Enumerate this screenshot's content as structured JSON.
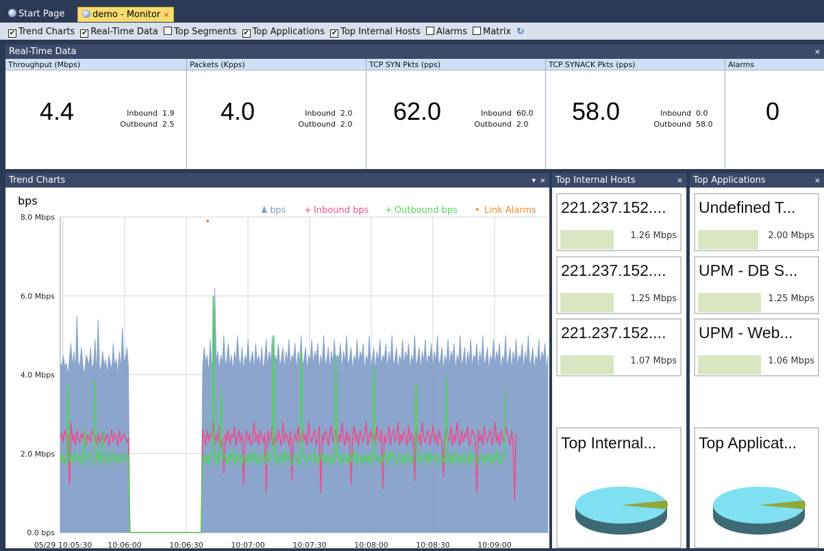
{
  "tabs": [
    {
      "label": "Start Page"
    },
    {
      "label": "demo - Monitor",
      "close": "×"
    }
  ],
  "toolbar": {
    "options": [
      {
        "label": "Trend Charts",
        "checked": true
      },
      {
        "label": "Real-Time Data",
        "checked": true
      },
      {
        "label": "Top Segments",
        "checked": false
      },
      {
        "label": "Top Applications",
        "checked": true
      },
      {
        "label": "Top Internal Hosts",
        "checked": true
      },
      {
        "label": "Alarms",
        "checked": false
      },
      {
        "label": "Matrix",
        "checked": false
      }
    ],
    "check_mark": "✔",
    "refresh_glyph": "↻"
  },
  "realtime": {
    "title": "Real-Time Data",
    "close": "×",
    "metrics": [
      {
        "header": "Throughput (Mbps)",
        "value": "4.4",
        "inbound_label": "Inbound",
        "inbound": "1.9",
        "outbound_label": "Outbound",
        "outbound": "2.5"
      },
      {
        "header": "Packets (Kpps)",
        "value": "4.0",
        "inbound_label": "Inbound",
        "inbound": "2.0",
        "outbound_label": "Outbound",
        "outbound": "2.0"
      },
      {
        "header": "TCP SYN Pkts (pps)",
        "value": "62.0",
        "inbound_label": "Inbound",
        "inbound": "60.0",
        "outbound_label": "Outbound",
        "outbound": "2.0"
      },
      {
        "header": "TCP SYNACK Pkts (pps)",
        "value": "58.0",
        "inbound_label": "Inbound",
        "inbound": "0.0",
        "outbound_label": "Outbound",
        "outbound": "58.0"
      },
      {
        "header": "Alarms",
        "value": "0"
      }
    ]
  },
  "trend": {
    "title": "Trend Charts",
    "dropdown": "▾",
    "close": "×"
  },
  "hosts": {
    "title": "Top Internal Hosts",
    "close": "×",
    "items": [
      {
        "name": "221.237.152....",
        "value": "1.26 Mbps"
      },
      {
        "name": "221.237.152....",
        "value": "1.25 Mbps"
      },
      {
        "name": "221.237.152....",
        "value": "1.07 Mbps"
      }
    ],
    "pie_title": "Top Internal..."
  },
  "apps": {
    "title": "Top Applications",
    "close": "×",
    "items": [
      {
        "name": "Undefined T...",
        "value": "2.00 Mbps"
      },
      {
        "name": "UPM - DB S...",
        "value": "1.25 Mbps"
      },
      {
        "name": "UPM - Web...",
        "value": "1.06 Mbps"
      }
    ],
    "pie_title": "Top Applicat..."
  },
  "colors": {
    "bps": "#7f9cc7",
    "inbound": "#e8508f",
    "outbound": "#4fd35a",
    "alarms": "#f0892a",
    "header_bg": "#3b4a66"
  },
  "chart_data": {
    "type": "area",
    "title": "bps",
    "xlabel": "",
    "ylabel": "bps",
    "ylim": [
      0,
      8
    ],
    "y_ticks": [
      "0.0 bps",
      "2.0 Mbps",
      "4.0 Mbps",
      "6.0 Mbps",
      "8.0 Mbps"
    ],
    "x_ticks": [
      "05/29 10:05:30",
      "10:06:00",
      "10:06:30",
      "10:07:00",
      "10:07:30",
      "10:08:00",
      "10:08:30",
      "10:09:00"
    ],
    "x_range": [
      "10:05:30",
      "10:09:15"
    ],
    "grid": true,
    "legend_position": "top-right",
    "legend": [
      "bps",
      "Inbound bps",
      "Outbound bps",
      "Link Alarms"
    ],
    "series": [
      {
        "name": "bps",
        "type": "area",
        "samples_per_30s": 24,
        "values": [
          4.3,
          4.2,
          4.5,
          4.2,
          4.3,
          4.0,
          4.4,
          4.8,
          4.2,
          4.6,
          4.1,
          5.5,
          4.2,
          4.3,
          4.7,
          4.2,
          4.0,
          4.5,
          4.4,
          4.2,
          4.7,
          4.1,
          4.3,
          4.9,
          4.0,
          5.4,
          4.1,
          4.2,
          4.6,
          4.2,
          4.4,
          4.0,
          4.5,
          4.3,
          4.1,
          4.8,
          4.2,
          4.4,
          4.0,
          4.6,
          4.1,
          5.2,
          4.3,
          4.4,
          4.7,
          4.2,
          0.0,
          0.0,
          0.0,
          0.0,
          0.0,
          0.0,
          0.0,
          0.0,
          0.0,
          0.0,
          0.0,
          0.0,
          0.0,
          0.0,
          0.0,
          0.0,
          0.0,
          0.0,
          0.0,
          0.0,
          0.0,
          0.0,
          0.0,
          0.0,
          0.0,
          0.0,
          0.0,
          0.0,
          0.0,
          0.0,
          0.0,
          0.0,
          0.0,
          0.0,
          0.0,
          0.0,
          0.0,
          0.0,
          0.0,
          0.0,
          0.0,
          0.0,
          0.0,
          0.0,
          0.0,
          0.0,
          0.0,
          0.0,
          4.2,
          4.7,
          4.3,
          4.5,
          4.0,
          4.9,
          4.2,
          4.4,
          6.2,
          4.3,
          4.6,
          4.1,
          4.5,
          4.3,
          5.0,
          4.2,
          4.4,
          4.8,
          4.2,
          4.5,
          4.1,
          4.6,
          4.3,
          5.0,
          4.4,
          4.2,
          4.7,
          4.1,
          4.5,
          4.3,
          4.9,
          4.2,
          4.4,
          4.6,
          4.1,
          4.8,
          4.3,
          4.5,
          4.2,
          4.7,
          4.1,
          4.4,
          4.9,
          4.2,
          4.6,
          4.3,
          5.0,
          4.1,
          4.5,
          4.3,
          4.8,
          4.2,
          4.4,
          4.7,
          4.1,
          4.6,
          4.3,
          4.9,
          4.2,
          4.5,
          4.4,
          4.8,
          4.1,
          4.6,
          4.3,
          5.0,
          4.2,
          4.4,
          4.7,
          4.1,
          4.5,
          4.3,
          4.9,
          4.2,
          4.6,
          4.4,
          4.8,
          4.1,
          4.5,
          4.3,
          5.0,
          4.2,
          4.4,
          4.7,
          4.1,
          4.6,
          4.3,
          4.9,
          4.2,
          4.5,
          4.4,
          4.8,
          4.1,
          4.6,
          4.3,
          5.0,
          4.2,
          4.4,
          4.7,
          4.1,
          4.5,
          4.3,
          4.9,
          4.2,
          4.6,
          4.4,
          4.8,
          4.1,
          4.5,
          4.3,
          5.0,
          4.2,
          4.4,
          4.7,
          4.1,
          4.6,
          4.3,
          4.9,
          4.2,
          4.5,
          4.4,
          4.8,
          4.1,
          4.6,
          4.3,
          5.0,
          4.2,
          4.4,
          4.7,
          4.1,
          4.5,
          4.3,
          4.9,
          4.2,
          4.6,
          4.4,
          4.8,
          4.1,
          4.5,
          4.3,
          5.0,
          4.2,
          4.4,
          4.7,
          4.1,
          4.6,
          4.3,
          4.9,
          4.2,
          4.5,
          4.4,
          4.8,
          4.1,
          4.6,
          4.3,
          5.0,
          4.2,
          4.4,
          4.7,
          4.1,
          4.5,
          4.3,
          4.9,
          4.2,
          4.6,
          4.4,
          4.8,
          4.1,
          4.5,
          4.3,
          5.0,
          4.2,
          4.4,
          4.7,
          4.1,
          4.6,
          4.3,
          4.9,
          4.2,
          4.5,
          4.4,
          4.8,
          4.1,
          4.6,
          4.3,
          5.0,
          4.2,
          4.4,
          4.7,
          4.1,
          4.5,
          4.3,
          4.9,
          4.2,
          4.6,
          4.4,
          4.8,
          4.1,
          4.5,
          4.3,
          5.0,
          4.2,
          4.4,
          4.7,
          4.1,
          4.6,
          4.3,
          4.9,
          4.2,
          4.5,
          4.4,
          4.8,
          4.1,
          4.6,
          4.3,
          5.0,
          4.2,
          4.4,
          4.7,
          4.1,
          4.5,
          4.3,
          4.9,
          4.2,
          4.6,
          4.4,
          4.8,
          4.1,
          4.5
        ]
      },
      {
        "name": "Inbound bps",
        "type": "line",
        "values": [
          2.4,
          2.5,
          2.3,
          2.6,
          2.4,
          2.5,
          1.2,
          2.8,
          2.3,
          2.5,
          2.2,
          2.6,
          2.4,
          2.3,
          2.5,
          2.4,
          2.6,
          2.2,
          2.5,
          2.4,
          2.3,
          2.6,
          2.5,
          2.4,
          2.2,
          2.5,
          2.3,
          2.4,
          2.6,
          2.3,
          2.4,
          2.5,
          2.2,
          2.4,
          2.6,
          2.3,
          2.5,
          2.4,
          2.2,
          2.6,
          2.3,
          2.4,
          2.5,
          2.4,
          2.3,
          2.4,
          0.0,
          0.0,
          0.0,
          0.0,
          0.0,
          0.0,
          0.0,
          0.0,
          0.0,
          0.0,
          0.0,
          0.0,
          0.0,
          0.0,
          0.0,
          0.0,
          0.0,
          0.0,
          0.0,
          0.0,
          0.0,
          0.0,
          0.0,
          0.0,
          0.0,
          0.0,
          0.0,
          0.0,
          0.0,
          0.0,
          0.0,
          0.0,
          0.0,
          0.0,
          0.0,
          0.0,
          0.0,
          0.0,
          0.0,
          0.0,
          0.0,
          0.0,
          0.0,
          0.0,
          0.0,
          0.0,
          0.0,
          0.0,
          2.6,
          2.4,
          2.2,
          2.6,
          2.3,
          2.5,
          2.4,
          2.8,
          2.2,
          2.5,
          2.3,
          2.7,
          2.2,
          2.4,
          1.5,
          2.5,
          2.3,
          2.6,
          2.2,
          2.5,
          2.4,
          2.7,
          2.2,
          2.4,
          2.6,
          2.3,
          2.5,
          1.2,
          2.4,
          2.6,
          2.3,
          2.5,
          2.2,
          2.4,
          2.8,
          2.3,
          2.5,
          2.2,
          2.6,
          2.4,
          2.3,
          2.5,
          1.0,
          2.6,
          2.3,
          2.4,
          2.7,
          2.2,
          2.5,
          2.3,
          2.6,
          2.4,
          2.2,
          2.8,
          2.3,
          2.5,
          2.4,
          2.2,
          2.6,
          1.3,
          2.4,
          2.5,
          2.3,
          2.7,
          2.2,
          2.4,
          2.6,
          2.3,
          2.5,
          2.2,
          2.8,
          2.4,
          2.3,
          2.5,
          2.6,
          2.2,
          2.4,
          2.7,
          1.0,
          2.5,
          2.3,
          2.6,
          2.4,
          2.2,
          2.5,
          2.7,
          2.3,
          2.4,
          2.6,
          2.2,
          2.5,
          2.3,
          2.8,
          2.4,
          2.2,
          2.6,
          2.3,
          2.5,
          1.2,
          2.4,
          2.7,
          2.3,
          2.5,
          2.2,
          2.6,
          2.4,
          2.3,
          2.5,
          2.8,
          2.2,
          2.4,
          2.6,
          2.3,
          2.5,
          2.2,
          2.7,
          2.4,
          2.3,
          2.6,
          1.1,
          2.5,
          2.3,
          2.4,
          2.7,
          2.2,
          2.5,
          2.6,
          2.3,
          2.4,
          2.8,
          2.2,
          2.5,
          2.3,
          2.6,
          2.4,
          2.2,
          2.7,
          2.3,
          2.5,
          2.4,
          1.3,
          2.6,
          2.3,
          2.5,
          2.2,
          2.8,
          2.4,
          2.3,
          2.5,
          2.6,
          2.2,
          2.4,
          2.7,
          2.3,
          2.5,
          2.2,
          2.6,
          2.4,
          2.3,
          1.4,
          2.5,
          2.6,
          2.3,
          2.4,
          2.7,
          2.2,
          2.5,
          2.3,
          2.8,
          2.4,
          2.2,
          2.6,
          2.3,
          2.5,
          2.4,
          2.7,
          2.2,
          2.3,
          2.6,
          2.5,
          2.4,
          1.0,
          2.6,
          2.3,
          2.5,
          2.2,
          2.7,
          2.4,
          2.3,
          2.5,
          2.6,
          2.2,
          2.4,
          2.8,
          2.3,
          2.5,
          2.2,
          2.6,
          2.4,
          2.3,
          2.7,
          2.5,
          2.4,
          2.2,
          2.6,
          2.3,
          0.8,
          2.5
        ]
      },
      {
        "name": "Outbound bps",
        "type": "line",
        "values": [
          1.9,
          1.8,
          2.0,
          1.7,
          1.9,
          3.8,
          1.8,
          2.0,
          1.7,
          1.9,
          2.1,
          1.8,
          1.9,
          2.0,
          1.7,
          1.9,
          2.6,
          1.8,
          1.9,
          2.0,
          1.8,
          1.7,
          1.9,
          3.9,
          1.8,
          2.0,
          1.9,
          1.7,
          2.6,
          1.8,
          1.9,
          2.0,
          1.7,
          1.9,
          2.1,
          1.8,
          1.9,
          2.0,
          1.7,
          1.9,
          1.8,
          2.0,
          1.9,
          1.8,
          1.9,
          2.0,
          0.0,
          0.0,
          0.0,
          0.0,
          0.0,
          0.0,
          0.0,
          0.0,
          0.0,
          0.0,
          0.0,
          0.0,
          0.0,
          0.0,
          0.0,
          0.0,
          0.0,
          0.0,
          0.0,
          0.0,
          0.0,
          0.0,
          0.0,
          0.0,
          0.0,
          0.0,
          0.0,
          0.0,
          0.0,
          0.0,
          0.0,
          0.0,
          0.0,
          0.0,
          0.0,
          0.0,
          0.0,
          0.0,
          0.0,
          0.0,
          0.0,
          0.0,
          0.0,
          0.0,
          0.0,
          0.0,
          0.0,
          0.0,
          1.9,
          2.0,
          1.8,
          1.9,
          1.7,
          2.0,
          1.9,
          6.0,
          1.8,
          2.0,
          1.7,
          1.9,
          3.6,
          1.8,
          2.0,
          1.9,
          1.7,
          2.0,
          1.8,
          1.9,
          2.1,
          1.7,
          1.9,
          2.0,
          1.8,
          1.9,
          1.7,
          2.0,
          1.9,
          1.8,
          2.0,
          1.7,
          1.9,
          2.1,
          1.8,
          1.9,
          1.7,
          2.0,
          1.9,
          1.8,
          2.0,
          1.9,
          1.7,
          2.1,
          1.8,
          1.9,
          2.0,
          5.0,
          1.7,
          1.9,
          1.8,
          2.0,
          1.9,
          1.7,
          2.1,
          1.8,
          1.9,
          2.0,
          1.8,
          1.7,
          1.9,
          2.0,
          1.8,
          1.9,
          1.7,
          4.6,
          1.9,
          2.0,
          1.8,
          1.7,
          1.9,
          2.0,
          1.8,
          1.9,
          2.1,
          1.7,
          1.9,
          1.8,
          2.0,
          1.9,
          1.7,
          2.0,
          1.8,
          1.9,
          2.0,
          1.7,
          1.9,
          1.8,
          4.5,
          1.9,
          2.0,
          1.7,
          1.9,
          1.8,
          2.0,
          1.9,
          1.7,
          2.0,
          1.8,
          1.9,
          2.1,
          1.7,
          1.9,
          2.0,
          1.8,
          1.9,
          1.7,
          2.0,
          1.9,
          1.8,
          2.0,
          1.7,
          1.9,
          4.2,
          1.8,
          1.9,
          2.0,
          1.7,
          1.9,
          1.8,
          2.0,
          1.9,
          1.7,
          2.1,
          1.8,
          1.9,
          2.0,
          1.8,
          1.7,
          1.9,
          2.0,
          1.8,
          1.9,
          1.7,
          2.0,
          1.9,
          1.8,
          2.0,
          1.7,
          1.9,
          2.1,
          3.8,
          1.9,
          1.7,
          2.0,
          1.9,
          1.8,
          2.0,
          1.9,
          1.7,
          2.1,
          1.8,
          1.9,
          2.0,
          1.8,
          1.7,
          1.9,
          2.0,
          1.8,
          1.9,
          1.7,
          4.0,
          1.9,
          1.8,
          2.0,
          1.7,
          1.9,
          2.1,
          1.8,
          1.9,
          1.7,
          2.0,
          1.9,
          1.8,
          2.0,
          1.9,
          1.7,
          2.1,
          1.8,
          1.9,
          2.0,
          1.8,
          1.7,
          1.9,
          2.0,
          1.8,
          1.9,
          1.7,
          2.0,
          1.9,
          1.8,
          2.0,
          1.7,
          1.9,
          2.1,
          1.8,
          1.9,
          1.7,
          2.0,
          1.9,
          3.6
        ]
      },
      {
        "name": "Link Alarms",
        "type": "point",
        "values": [
          {
            "x": "10:06:42",
            "y": 7.9
          }
        ]
      }
    ]
  }
}
